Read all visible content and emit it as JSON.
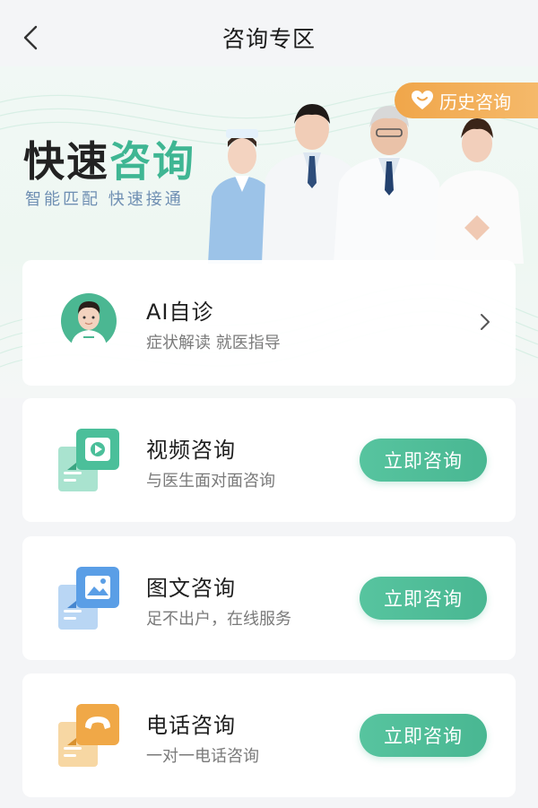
{
  "header": {
    "title": "咨询专区"
  },
  "banner": {
    "title_part1": "快速",
    "title_part2": "咨询",
    "subtitle": "智能匹配 快速接通",
    "history_label": "历史咨询"
  },
  "ai_card": {
    "title": "AI自诊",
    "desc": "症状解读 就医指导"
  },
  "services": [
    {
      "title": "视频咨询",
      "desc": "与医生面对面咨询",
      "button": "立即咨询",
      "icon": "video-icon"
    },
    {
      "title": "图文咨询",
      "desc": "足不出户，在线服务",
      "button": "立即咨询",
      "icon": "image-icon"
    },
    {
      "title": "电话咨询",
      "desc": "一对一电话咨询",
      "button": "立即咨询",
      "icon": "phone-icon"
    }
  ],
  "colors": {
    "accent": "#49b792",
    "history": "#f0a64a",
    "background": "#f4f5f7"
  }
}
